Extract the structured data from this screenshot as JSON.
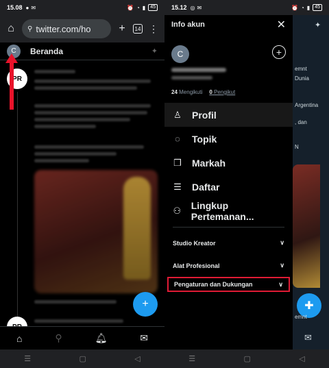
{
  "left": {
    "status": {
      "time": "15.08",
      "battery": "45"
    },
    "browser": {
      "url": "twitter.com/ho",
      "tabs": "14"
    },
    "twitter_header": {
      "avatar_letter": "C",
      "title": "Beranda"
    },
    "tweet": {
      "avatar_text": "PR"
    }
  },
  "right": {
    "status": {
      "time": "15.12",
      "battery": "45"
    },
    "drawer": {
      "title": "Info akun",
      "avatar_letter": "C",
      "following_count": "24",
      "following_label": "Mengikuti",
      "followers_count": "0",
      "followers_label": "Pengikut",
      "menu": [
        {
          "label": "Profil",
          "icon": "person-icon"
        },
        {
          "label": "Topik",
          "icon": "topic-icon"
        },
        {
          "label": "Markah",
          "icon": "bookmark-icon"
        },
        {
          "label": "Daftar",
          "icon": "list-icon"
        },
        {
          "label": "Lingkup Pertemanan...",
          "icon": "circle-icon"
        }
      ],
      "sections": [
        {
          "label": "Studio Kreator"
        },
        {
          "label": "Alat Profesional"
        },
        {
          "label": "Pengaturan dan Dukungan"
        }
      ]
    },
    "strip": [
      "emnt",
      "Dunia",
      "Argentina",
      ", dan",
      "N",
      "emnt"
    ]
  },
  "colors": {
    "accent": "#1d9bf0",
    "highlight": "#e01b35",
    "arrow": "#e8132a"
  }
}
